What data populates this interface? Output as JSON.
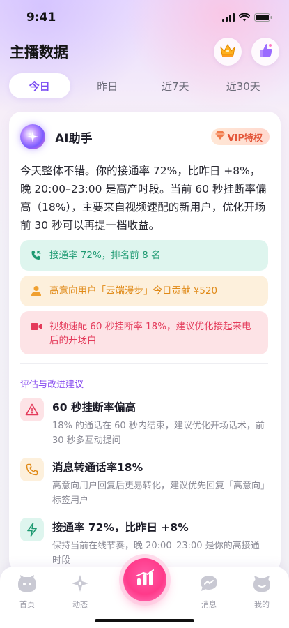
{
  "status_bar": {
    "time": "9:41"
  },
  "header": {
    "title": "主播数据",
    "crown_icon": "crown-icon",
    "thumb_icon": "thumbs-up-icon"
  },
  "tabs": [
    {
      "label": "今日",
      "active": true
    },
    {
      "label": "昨日",
      "active": false
    },
    {
      "label": "近7天",
      "active": false
    },
    {
      "label": "近30天",
      "active": false
    }
  ],
  "ai_card": {
    "title": "AI助手",
    "vip_badge": "VIP特权",
    "summary": "今天整体不错。你的接通率 72%，比昨日 +8%，晚 20:00–23:00 是高产时段。当前 60 秒挂断率偏高（18%），主要来自视频速配的新用户，优化开场前 30 秒可以再提一档收益。",
    "insights": [
      {
        "text": "接通率 72%，排名前 8 名",
        "icon": "phone-incoming-icon",
        "color": "#1e9a72"
      },
      {
        "text": "高意向用户「云端漫步」今日贡献 ¥520",
        "icon": "user-icon",
        "color": "#e08a18"
      },
      {
        "text": "视频速配 60 秒挂断率 18%，建议优化接起来电后的开场白",
        "icon": "video-icon",
        "color": "#e43a5a"
      }
    ],
    "section_label": "评估与改进建议",
    "suggestions": [
      {
        "title": "60 秒挂断率偏高",
        "desc": "18% 的通话在 60 秒内结束，建议优化开场话术，前 30 秒多互动提问",
        "icon": "warning-icon"
      },
      {
        "title": "消息转通话率18%",
        "desc": "高意向用户回复后更易转化，建议优先回复「高意向」标签用户",
        "icon": "phone-icon"
      },
      {
        "title": "接通率 72%，比昨日 +8%",
        "desc": "保持当前在线节奏，晚 20:00–23:00 是你的高接通时段",
        "icon": "lightning-icon"
      }
    ]
  },
  "tabbar": [
    {
      "label": "首页",
      "icon": "home-icon"
    },
    {
      "label": "动态",
      "icon": "sparkle-icon"
    },
    {
      "label": "",
      "icon": "data-chart-icon"
    },
    {
      "label": "消息",
      "icon": "message-icon"
    },
    {
      "label": "我的",
      "icon": "profile-icon"
    }
  ],
  "colors": {
    "accent": "#7a4cf2",
    "pink": "#ff3a8a"
  }
}
